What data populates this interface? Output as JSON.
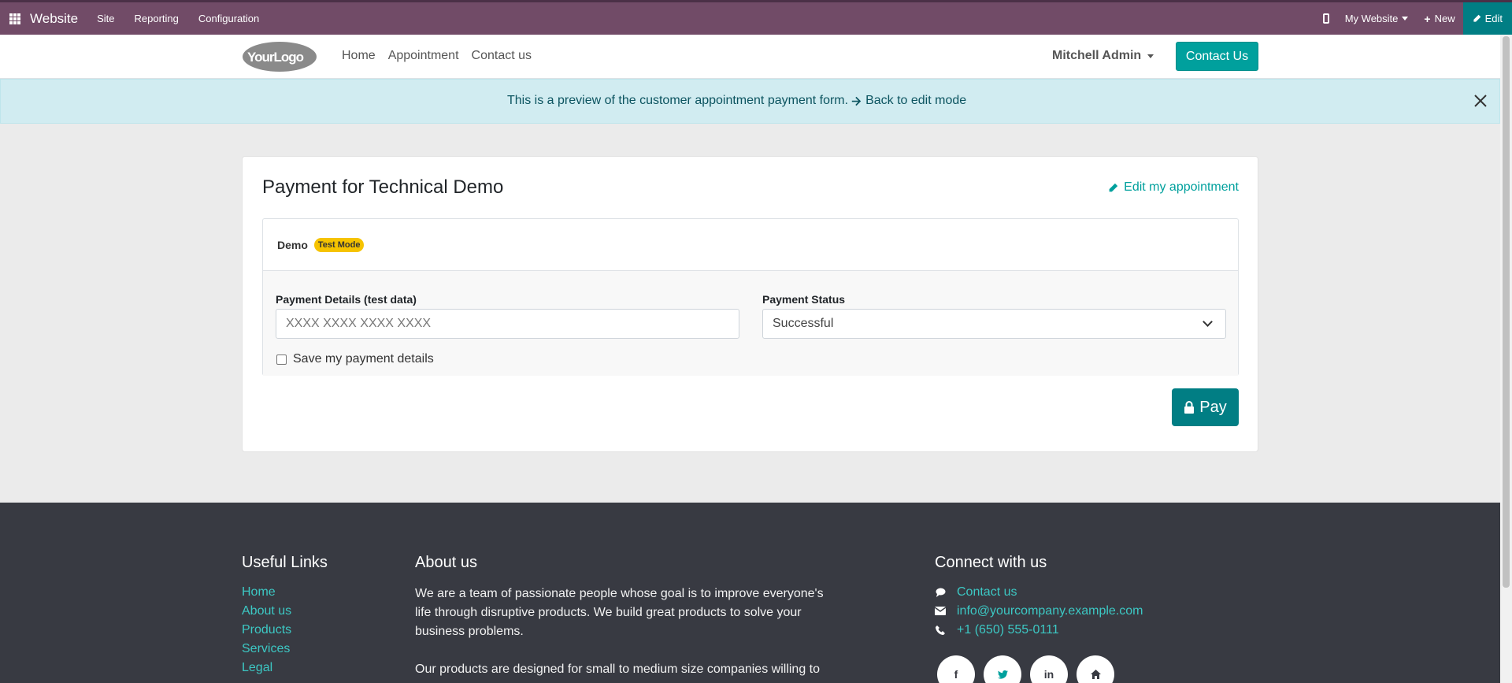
{
  "admin_bar": {
    "brand": "Website",
    "menu": [
      "Site",
      "Reporting",
      "Configuration"
    ],
    "website_switcher": "My Website",
    "new_label": "New",
    "edit_label": "Edit"
  },
  "header": {
    "logo_text": "YourLogo",
    "nav": [
      "Home",
      "Appointment",
      "Contact us"
    ],
    "user_name": "Mitchell Admin",
    "contact_button": "Contact Us"
  },
  "alert": {
    "message": "This is a preview of the customer appointment payment form.",
    "link": "Back to edit mode"
  },
  "payment": {
    "title": "Payment for Technical Demo",
    "edit_link": "Edit my appointment",
    "provider_name": "Demo",
    "provider_badge": "Test Mode",
    "details_label": "Payment Details (test data)",
    "details_placeholder": "XXXX XXXX XXXX XXXX",
    "status_label": "Payment Status",
    "status_value": "Successful",
    "save_label": "Save my payment details",
    "pay_label": "Pay"
  },
  "footer": {
    "useful_links_title": "Useful Links",
    "useful_links": [
      "Home",
      "About us",
      "Products",
      "Services",
      "Legal"
    ],
    "about_title": "About us",
    "about_p1": "We are a team of passionate people whose goal is to improve everyone's life through disruptive products. We build great products to solve your business problems.",
    "about_p2": "Our products are designed for small to medium size companies willing to",
    "connect_title": "Connect with us",
    "connect": [
      "Contact us",
      "info@yourcompany.example.com",
      "+1 (650) 555-0111"
    ]
  },
  "colors": {
    "admin_bar": "#714B67",
    "primary": "#00a09d",
    "edit_accent": "#017e84",
    "footer_bg": "#383a42"
  }
}
